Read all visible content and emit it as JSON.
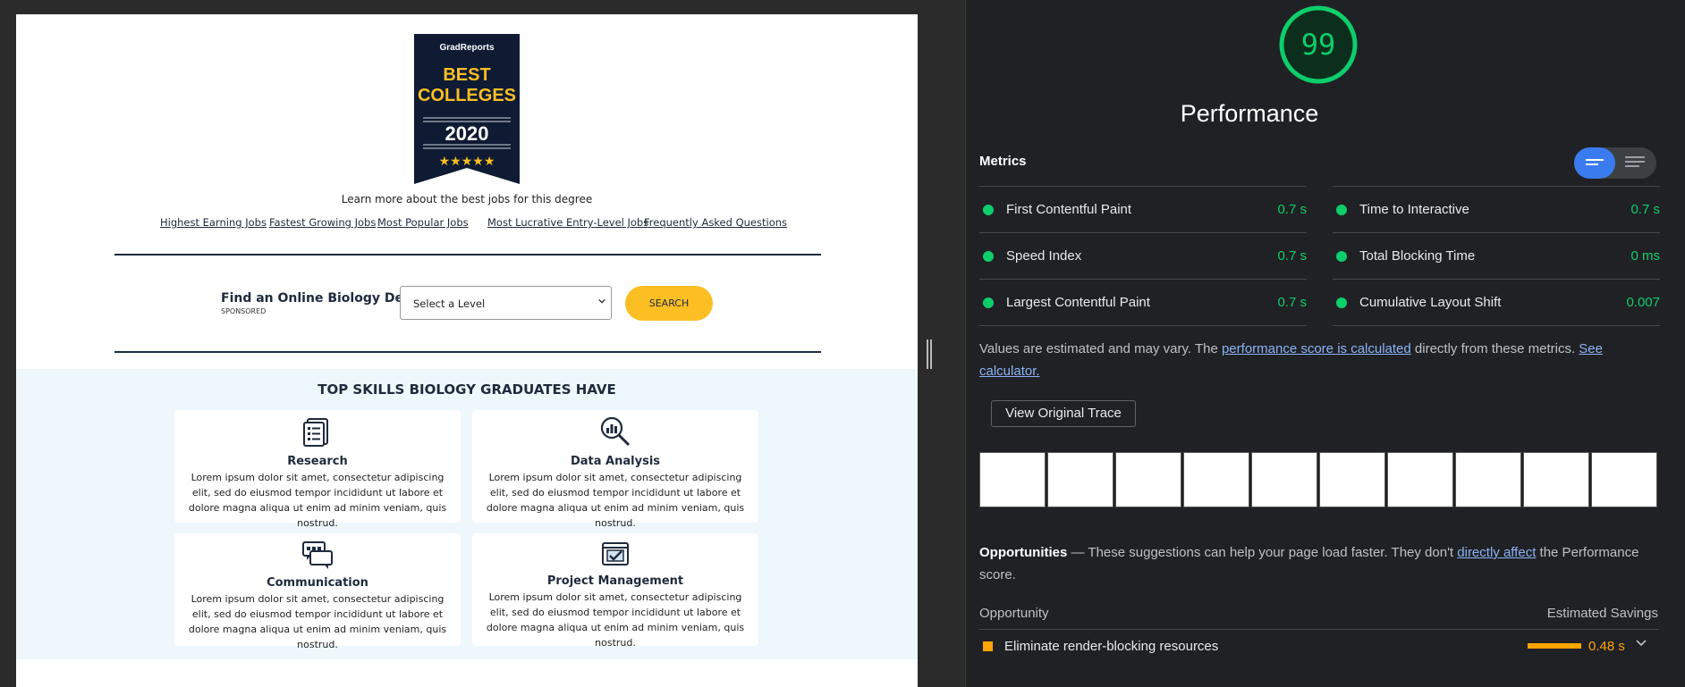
{
  "page": {
    "badge": {
      "brand": "GradReports",
      "line1": "BEST",
      "line2": "COLLEGES",
      "year": "2020",
      "stars": "★★★★★"
    },
    "learn_more": "Learn more about the best jobs for this degree",
    "links": [
      "Highest Earning Jobs",
      "Fastest Growing Jobs",
      "Most Popular Jobs",
      "Most Lucrative Entry-Level Jobs",
      "Frequently Asked Questions"
    ],
    "find_degree": {
      "title": "Find an Online Biology Degree:",
      "sponsored": "SPONSORED",
      "select_value": "Select a Level",
      "button": "SEARCH"
    },
    "skills": {
      "title": "TOP SKILLS BIOLOGY GRADUATES HAVE",
      "cards": [
        {
          "title": "Research",
          "icon": "clipboard-list-icon",
          "text": "Lorem ipsum dolor sit amet, consectetur adipiscing elit, sed do eiusmod tempor incididunt ut labore et dolore magna aliqua ut enim ad minim veniam, quis nostrud."
        },
        {
          "title": "Data Analysis",
          "icon": "magnifier-chart-icon",
          "text": "Lorem ipsum dolor sit amet, consectetur adipiscing elit, sed do eiusmod tempor incididunt ut labore et dolore magna aliqua ut enim ad minim veniam, quis nostrud."
        },
        {
          "title": "Communication",
          "icon": "chat-bubbles-icon",
          "text": "Lorem ipsum dolor sit amet, consectetur adipiscing elit, sed do eiusmod tempor incididunt ut labore et dolore magna aliqua ut enim ad minim veniam, quis nostrud."
        },
        {
          "title": "Project Management",
          "icon": "checklist-window-icon",
          "text": "Lorem ipsum dolor sit amet, consectetur adipiscing elit, sed do eiusmod tempor incididunt ut labore et dolore magna aliqua ut enim ad minim veniam, quis nostrud."
        }
      ]
    }
  },
  "lighthouse": {
    "score": "99",
    "score_color": "#0cce6b",
    "category": "Performance",
    "metrics_heading": "Metrics",
    "metrics": [
      {
        "label": "First Contentful Paint",
        "value": "0.7 s"
      },
      {
        "label": "Time to Interactive",
        "value": "0.7 s"
      },
      {
        "label": "Speed Index",
        "value": "0.7 s"
      },
      {
        "label": "Total Blocking Time",
        "value": "0 ms"
      },
      {
        "label": "Largest Contentful Paint",
        "value": "0.7 s"
      },
      {
        "label": "Cumulative Layout Shift",
        "value": "0.007"
      }
    ],
    "note": {
      "prefix": "Values are estimated and may vary. The ",
      "link1": "performance score is calculated",
      "middle": " directly from these metrics. ",
      "link2": "See calculator."
    },
    "trace_button": "View Original Trace",
    "opportunities": {
      "heading": "Opportunities",
      "dash": " — ",
      "prefix": "These suggestions can help your page load faster. They don't ",
      "link": "directly affect",
      "suffix": " the Performance score.",
      "col_left": "Opportunity",
      "col_right": "Estimated Savings",
      "items": [
        {
          "label": "Eliminate render-blocking resources",
          "value": "0.48 s",
          "color": "#ffa400"
        }
      ]
    }
  }
}
